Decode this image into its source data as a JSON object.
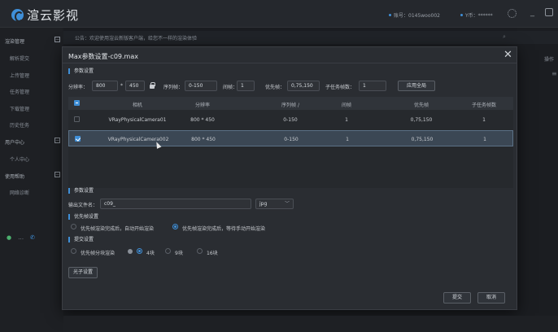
{
  "app": {
    "logo_text": "渲云影视",
    "account_label": "账号：0145woo002",
    "balance_label": "Y币：******"
  },
  "sidebar": {
    "items": [
      {
        "label": "渲染管理",
        "group": true
      },
      {
        "label": "解析提交"
      },
      {
        "label": "上传管理"
      },
      {
        "label": "任务管理"
      },
      {
        "label": "下载管理"
      },
      {
        "label": "历史任务"
      },
      {
        "label": "用户中心",
        "group": true
      },
      {
        "label": "个人中心"
      },
      {
        "label": "使用帮助",
        "group": true
      },
      {
        "label": "网络诊断"
      }
    ],
    "toggle_glyph": "−",
    "bottom_icons": [
      "●",
      "…",
      "✆"
    ]
  },
  "notice": {
    "text": "公告：欢迎使用渲云新版客户端，给您不一样的渲染体验",
    "extra": "操作",
    "search_glyph": "⌕"
  },
  "modal": {
    "title": "Max参数设置-c09.max",
    "close_glyph": "✕",
    "params_section": "参数设置",
    "resolution_label": "分辨率：",
    "width": "800",
    "times": "*",
    "height": "450",
    "frame_range_label": "序列帧：",
    "frame_range": "0-150",
    "interval_label": "间帧：",
    "interval": "1",
    "priority_label": "优先帧：",
    "priority": "0,75,150",
    "subtask_label": "子任务帧数：",
    "subtask": "1",
    "apply_all": "应用全局",
    "table": {
      "headers": [
        "相机",
        "分辨率",
        "序列帧  /",
        "间帧",
        "优先帧",
        "子任务帧数"
      ],
      "rows": [
        {
          "checked": false,
          "camera": "VRayPhysicalCamera01",
          "resolution": "800 * 450",
          "frames": "0-150",
          "interval": "1",
          "priority": "0,75,150",
          "subtask": "1"
        },
        {
          "checked": true,
          "camera": "VRayPhysicalCamera002",
          "resolution": "800 * 450",
          "frames": "0-150",
          "interval": "1",
          "priority": "0,75,150",
          "subtask": "1"
        }
      ]
    },
    "params2_section": "参数设置",
    "output_label": "输出文件名：",
    "output_name": "c09_",
    "format": "jpg",
    "priority_section": "优先帧设置",
    "priority_opt1": "优先帧渲染完成后，自动开始渲染",
    "priority_opt2": "优先帧渲染完成后，等待手动开始渲染",
    "submit_section": "提交设置",
    "split_label": "优先帧分块渲染",
    "block_opts": [
      "4块",
      "9块",
      "16块"
    ],
    "photon_button": "光子设置",
    "submit_button": "提交",
    "cancel_button": "取消"
  },
  "colors": {
    "accent": "#3f8fd8",
    "modal_bg": "#2a2d32",
    "selected_row": "#3b4754"
  }
}
